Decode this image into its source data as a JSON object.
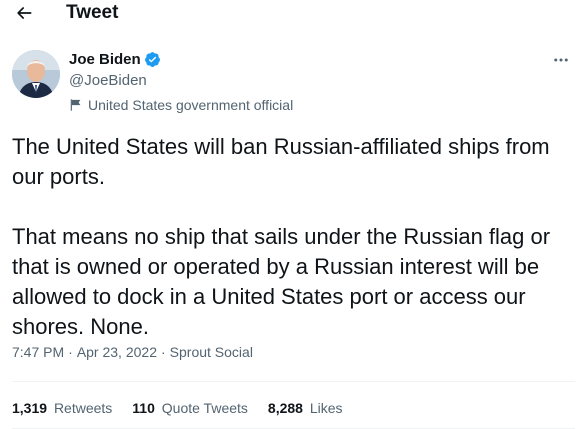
{
  "header": {
    "back_icon": "arrow-left-icon",
    "title": "Tweet"
  },
  "author": {
    "display_name": "Joe Biden",
    "verified_icon": "verified-badge-icon",
    "handle": "@JoeBiden",
    "label_icon": "flag-icon",
    "label": "United States government official"
  },
  "more_icon": "more-horizontal-icon",
  "tweet": {
    "paragraphs": [
      "The United States will ban Russian-affiliated ships from our ports.",
      "That means no ship that sails under the Russian flag or that is owned or operated by a Russian interest will be allowed to dock in a United States port or access our shores. None."
    ]
  },
  "meta": {
    "time": "7:47 PM",
    "separator": "·",
    "date": "Apr 23, 2022",
    "source": "Sprout Social"
  },
  "stats": {
    "retweets_count": "1,319",
    "retweets_label": "Retweets",
    "quotes_count": "110",
    "quotes_label": "Quote Tweets",
    "likes_count": "8,288",
    "likes_label": "Likes"
  },
  "colors": {
    "text": "#0f1419",
    "secondary": "#536471",
    "verified_blue": "#1d9bf0",
    "divider": "#eff3f4"
  }
}
